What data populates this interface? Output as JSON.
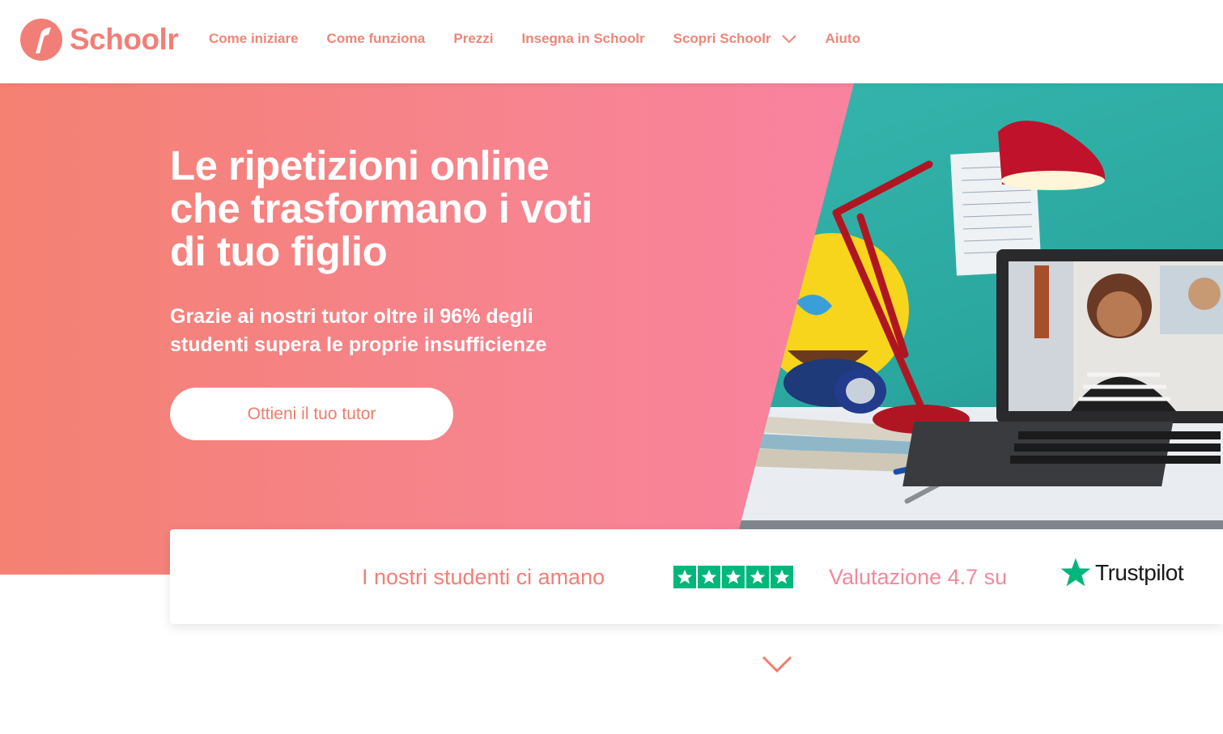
{
  "brand": {
    "name": "Schoolr",
    "color": "#f27f77"
  },
  "nav": {
    "items": [
      {
        "label": "Come iniziare"
      },
      {
        "label": "Come funziona"
      },
      {
        "label": "Prezzi"
      },
      {
        "label": "Insegna in Schoolr"
      },
      {
        "label": "Scopri Schoolr",
        "icon": "chevron-down-icon"
      },
      {
        "label": "Aiuto"
      }
    ]
  },
  "hero": {
    "title_lines": [
      "Le ripetizioni online",
      "che trasformano i voti",
      "di tuo figlio"
    ],
    "subtitle_lines": [
      "Grazie ai nostri tutor oltre il 96% degli",
      "studenti supera le proprie insufficienze"
    ],
    "cta_label": "Ottieni il tuo tutor",
    "gradient": [
      "#f48172",
      "#fc80b2"
    ]
  },
  "rating": {
    "love_text": "I nostri studenti ci amano",
    "score_text": "Valutazione 4.7 su",
    "stars": 5,
    "provider": "Trustpilot",
    "star_color": "#00b67a"
  },
  "scroll": {
    "icon": "chevron-down-icon",
    "color": "#f07d6c"
  }
}
